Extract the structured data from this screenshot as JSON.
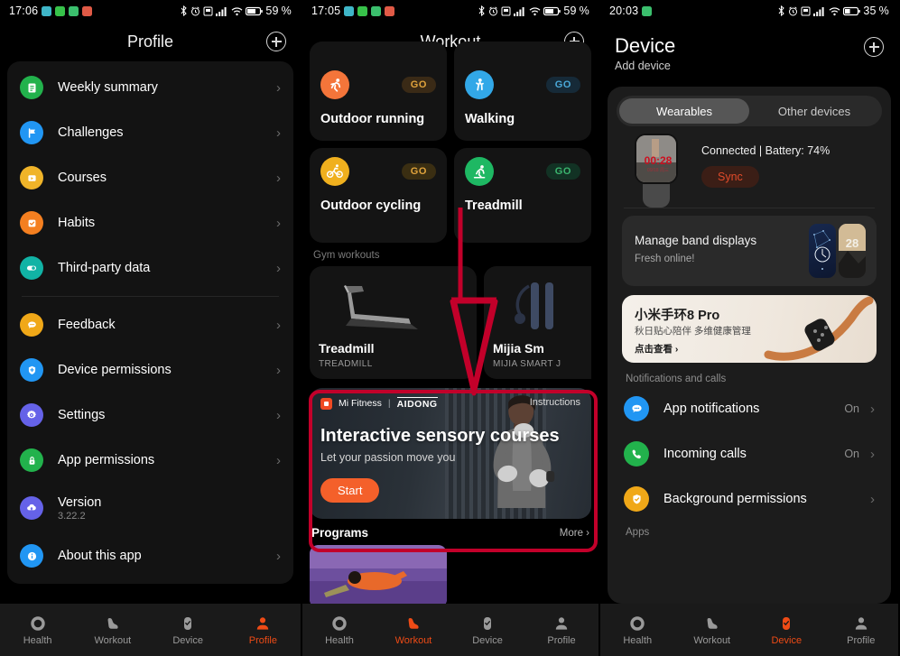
{
  "profile": {
    "status": {
      "time": "17:06",
      "battery": "59",
      "app_icons": [
        "w-app-icon",
        "download-icon",
        "calendar-icon",
        "photos-icon"
      ],
      "icons": [
        "bluetooth-icon",
        "alarm-icon",
        "sd-card-icon",
        "signal-icon",
        "wifi-icon",
        "battery-icon"
      ]
    },
    "header": {
      "title": "Profile",
      "add_label": "+"
    },
    "items_top": [
      {
        "label": "Weekly summary",
        "icon": "document-icon",
        "color": "#22b24c"
      },
      {
        "label": "Challenges",
        "icon": "flag-icon",
        "color": "#2196f3"
      },
      {
        "label": "Courses",
        "icon": "play-icon",
        "color": "#f0b429"
      },
      {
        "label": "Habits",
        "icon": "checklist-icon",
        "color": "#f47f20"
      },
      {
        "label": "Third-party data",
        "icon": "toggle-icon",
        "color": "#11b3a5"
      }
    ],
    "items_bottom": [
      {
        "label": "Feedback",
        "icon": "chat-icon",
        "color": "#f0a818"
      },
      {
        "label": "Device permissions",
        "icon": "shield-plus-icon",
        "color": "#2196f3"
      },
      {
        "label": "Settings",
        "icon": "gear-icon",
        "color": "#6562e8"
      },
      {
        "label": "App permissions",
        "icon": "lock-icon",
        "color": "#22b24c"
      },
      {
        "label": "Version",
        "sub": "3.22.2",
        "icon": "cloud-icon",
        "color": "#6562e8",
        "no_chevron": true
      },
      {
        "label": "About this app",
        "icon": "info-icon",
        "color": "#2196f3"
      }
    ],
    "nav": [
      {
        "label": "Health",
        "icon": "ring-icon",
        "active": false
      },
      {
        "label": "Workout",
        "icon": "shoe-icon",
        "active": false
      },
      {
        "label": "Device",
        "icon": "band-icon",
        "active": false
      },
      {
        "label": "Profile",
        "icon": "person-icon",
        "active": true
      }
    ]
  },
  "workout": {
    "status": {
      "time": "17:05",
      "battery": "59",
      "app_icons": [
        "w-app-icon",
        "download-icon",
        "calendar-icon",
        "photos-icon"
      ]
    },
    "header": {
      "title": "Workout",
      "add_label": "+"
    },
    "cards": [
      {
        "name": "Outdoor running",
        "go": "GO",
        "icon": "runner-icon",
        "color": "#f4753a",
        "pill_bg": "#3a2a16",
        "pill_fg": "#e0a33c"
      },
      {
        "name": "Walking",
        "go": "GO",
        "icon": "walker-icon",
        "color": "#32a8e8",
        "pill_bg": "#162a38",
        "pill_fg": "#4aa8d8"
      },
      {
        "name": "Outdoor cycling",
        "go": "GO",
        "icon": "bicycle-icon",
        "color": "#f0b01e",
        "pill_bg": "#3a2e12",
        "pill_fg": "#e0a33c"
      },
      {
        "name": "Treadmill",
        "go": "GO",
        "icon": "treadmill-runner-icon",
        "color": "#1eb863",
        "pill_bg": "#123224",
        "pill_fg": "#3bb56e"
      }
    ],
    "gym_section_title": "Gym workouts",
    "gym_cards": [
      {
        "name": "Treadmill",
        "sub": "TREADMILL",
        "icon": "treadmill-device-icon"
      },
      {
        "name": "Mijia Sm",
        "sub": "MIJIA SMART J",
        "icon": "jump-rope-icon"
      }
    ],
    "banner": {
      "brand": "Mi Fitness",
      "separator": "|",
      "partner": "AIDONG",
      "instructions": "Instructions",
      "headline": "Interactive sensory courses",
      "subhead": "Let your passion move you",
      "cta": "Start"
    },
    "programs": {
      "label": "Programs",
      "more": "More ›"
    },
    "nav": [
      {
        "label": "Health",
        "icon": "ring-icon",
        "active": false
      },
      {
        "label": "Workout",
        "icon": "shoe-icon",
        "active": true
      },
      {
        "label": "Device",
        "icon": "band-icon",
        "active": false
      },
      {
        "label": "Profile",
        "icon": "person-icon",
        "active": false
      }
    ]
  },
  "device": {
    "status": {
      "time": "20:03",
      "battery": "35",
      "app_icons": [
        "calendar-icon"
      ]
    },
    "header": {
      "title": "Device",
      "subtitle": "Add device",
      "add_label": "+"
    },
    "tabs": [
      {
        "label": "Wearables",
        "active": true
      },
      {
        "label": "Other devices",
        "active": false
      }
    ],
    "connection": {
      "status_text": "Connected | Battery: 74%",
      "sync_label": "Sync"
    },
    "band_card": {
      "title": "Manage band displays",
      "subtitle": "Fresh online!"
    },
    "promo": {
      "title": "小米手环8 Pro",
      "subtitle": "秋日贴心陪伴 多维健康管理",
      "link": "点击查看 ›"
    },
    "section_notifications": "Notifications and calls",
    "notification_rows": [
      {
        "label": "App notifications",
        "value": "On",
        "icon": "chat-bubble-icon",
        "color": "#2196f3"
      },
      {
        "label": "Incoming calls",
        "value": "On",
        "icon": "phone-icon",
        "color": "#22b24c"
      },
      {
        "label": "Background permissions",
        "value": "",
        "icon": "shield-check-icon",
        "color": "#f0a818"
      }
    ],
    "section_apps": "Apps",
    "nav": [
      {
        "label": "Health",
        "icon": "ring-icon",
        "active": false
      },
      {
        "label": "Workout",
        "icon": "shoe-icon",
        "active": false
      },
      {
        "label": "Device",
        "icon": "band-icon",
        "active": true
      },
      {
        "label": "Profile",
        "icon": "person-icon",
        "active": false
      }
    ]
  },
  "annotations": {
    "highlight_color": "#c2002a",
    "target": "interactive-sensory-courses-banner",
    "arrow": "downward-arrow"
  }
}
